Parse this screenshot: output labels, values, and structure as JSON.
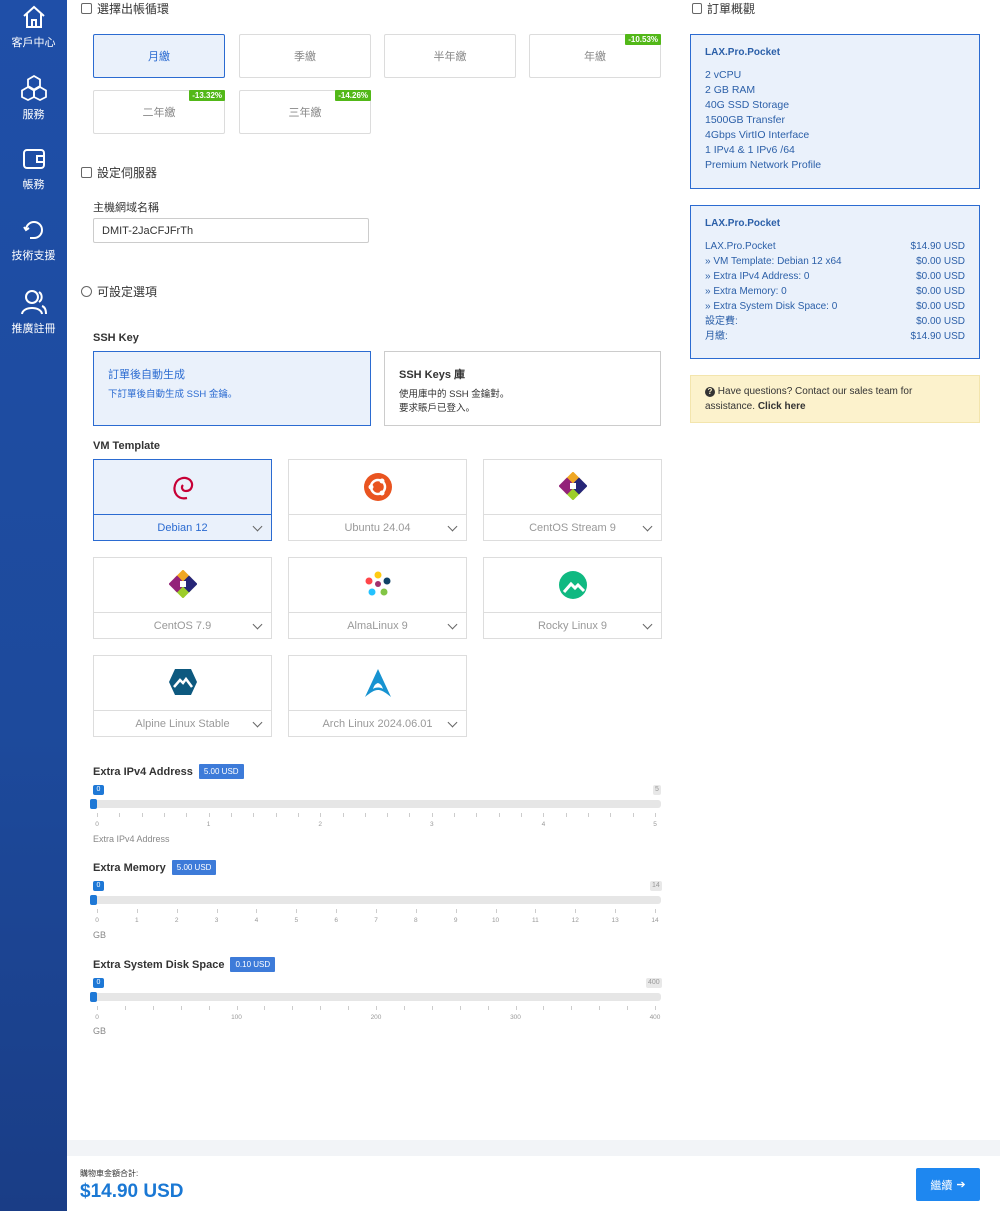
{
  "sidebar": {
    "items": [
      {
        "label": "客戶中心",
        "icon": "home-icon"
      },
      {
        "label": "服務",
        "icon": "cubes-icon"
      },
      {
        "label": "帳務",
        "icon": "wallet-icon"
      },
      {
        "label": "技術支援",
        "icon": "support-icon"
      },
      {
        "label": "推廣註冊",
        "icon": "users-icon"
      }
    ]
  },
  "billing": {
    "title": "選擇出帳循環",
    "cycles": [
      {
        "label": "月繳",
        "discount": ""
      },
      {
        "label": "季繳",
        "discount": ""
      },
      {
        "label": "半年繳",
        "discount": ""
      },
      {
        "label": "年繳",
        "discount": "-10.53%"
      },
      {
        "label": "二年繳",
        "discount": "-13.32%"
      },
      {
        "label": "三年繳",
        "discount": "-14.26%"
      }
    ]
  },
  "server": {
    "title": "設定伺服器",
    "hostname_label": "主機網域名稱",
    "hostname_value": "DMIT-2JaCFJFrTh"
  },
  "options": {
    "title": "可設定選項",
    "ssh_label": "SSH Key",
    "ssh_cards": [
      {
        "title": "訂單後自動生成",
        "desc1": "下訂單後自動生成 SSH 金鑰。",
        "desc2": ""
      },
      {
        "title": "SSH Keys 庫",
        "desc1": "使用庫中的 SSH 金鑰對。",
        "desc2": "要求賬戶已登入。"
      }
    ],
    "vm_label": "VM Template",
    "vm_templates": [
      "Debian 12",
      "Ubuntu 24.04",
      "CentOS Stream 9",
      "CentOS 7.9",
      "AlmaLinux 9",
      "Rocky Linux 9",
      "Alpine Linux Stable",
      "Arch Linux 2024.06.01"
    ]
  },
  "sliders": [
    {
      "title": "Extra IPv4 Address",
      "price": "5.00 USD",
      "value": "0",
      "max": "5",
      "ticks": [
        "0",
        "1",
        "2",
        "3",
        "4",
        "5"
      ],
      "unit": "Extra IPv4 Address"
    },
    {
      "title": "Extra Memory",
      "price": "5.00 USD",
      "value": "0",
      "max": "14",
      "ticks": [
        "0",
        "1",
        "2",
        "3",
        "4",
        "5",
        "6",
        "7",
        "8",
        "9",
        "10",
        "11",
        "12",
        "13",
        "14"
      ],
      "unit": "GB"
    },
    {
      "title": "Extra System Disk Space",
      "price": "0.10 USD",
      "value": "0",
      "max": "400",
      "ticks": [
        "0",
        "100",
        "200",
        "300",
        "400"
      ],
      "unit": "GB"
    }
  ],
  "summary": {
    "title": "訂單概觀",
    "product": "LAX.Pro.Pocket",
    "specs": [
      "2 vCPU",
      "2 GB RAM",
      "40G SSD Storage",
      "1500GB Transfer",
      "4Gbps VirtIO Interface",
      "1 IPv4 & 1 IPv6 /64",
      "Premium Network Profile"
    ],
    "rows": [
      {
        "name": "LAX.Pro.Pocket",
        "price": "$14.90 USD"
      },
      {
        "name": " » VM Template: Debian 12 x64",
        "price": "$0.00 USD"
      },
      {
        "name": " » Extra IPv4 Address: 0",
        "price": "$0.00 USD"
      },
      {
        "name": " » Extra Memory: 0",
        "price": "$0.00 USD"
      },
      {
        "name": " » Extra System Disk Space: 0",
        "price": "$0.00 USD"
      },
      {
        "name": "設定費:",
        "price": "$0.00 USD"
      },
      {
        "name": "月繳:",
        "price": "$14.90 USD"
      }
    ],
    "help_text": "Have questions? Contact our sales team for assistance.",
    "help_link": "Click here"
  },
  "footer": {
    "total_label": "購物車金額合計:",
    "total": "$14.90 USD",
    "continue_label": "繼續"
  }
}
